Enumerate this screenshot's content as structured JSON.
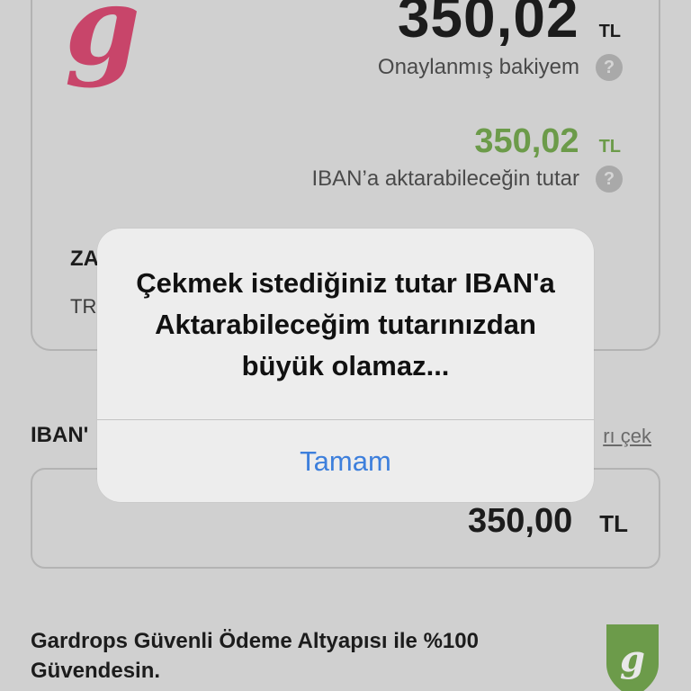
{
  "balance": {
    "approved_amount": "350,02",
    "approved_currency": "TL",
    "approved_label": "Onaylanmış bakiyem",
    "transferable_amount": "350,02",
    "transferable_currency": "TL",
    "transferable_label": "IBAN’a aktarabileceğin tutar",
    "help_glyph": "?"
  },
  "bank": {
    "name_partial": "ZA",
    "iban_partial": "TR"
  },
  "withdraw": {
    "section_label_partial": "IBAN'",
    "link_partial": "rı çek",
    "input_amount": "350,00",
    "input_currency": "TL"
  },
  "footer": {
    "security_text": "Gardrops Güvenli Ödeme Altyapısı ile %100 Güvendesin."
  },
  "alert": {
    "message": "Çekmek istediğiniz tutar IBAN'a Aktarabileceğim tutarınızdan büyük olamaz...",
    "ok_label": "Tamam"
  },
  "colors": {
    "brand": "#c8456a",
    "green": "#6c9b4a",
    "link_blue": "#3d7fdc"
  },
  "icons": {
    "brand": "gardrops-g-logo",
    "help": "question-circle-icon",
    "shield": "gardrops-shield-icon"
  }
}
